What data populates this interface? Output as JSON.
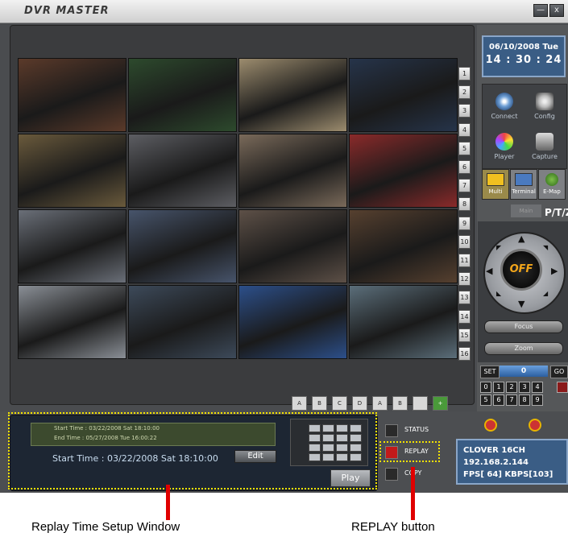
{
  "app": {
    "title": "DVR MASTER",
    "win_min": "—",
    "win_close": "x"
  },
  "camera_grid": {
    "cells": [
      {
        "c": "#5b3a2a"
      },
      {
        "c": "#2d4a2d"
      },
      {
        "c": "#9c8c6e"
      },
      {
        "c": "#26344a"
      },
      {
        "c": "#6a5a3c"
      },
      {
        "c": "#5d5e63"
      },
      {
        "c": "#7a6a5a"
      },
      {
        "c": "#8a2a2a"
      },
      {
        "c": "#6a6f78"
      },
      {
        "c": "#47546b"
      },
      {
        "c": "#5d5047"
      },
      {
        "c": "#56402f"
      },
      {
        "c": "#8a8f96"
      },
      {
        "c": "#3d4a5a"
      },
      {
        "c": "#2c4f8a"
      },
      {
        "c": "#5b6e7a"
      }
    ],
    "channels": [
      "1",
      "2",
      "3",
      "4",
      "5",
      "6",
      "7",
      "8",
      "9",
      "10",
      "11",
      "12",
      "13",
      "14",
      "15",
      "16"
    ],
    "layout_buttons": [
      "A",
      "B",
      "C",
      "D",
      "A",
      "B",
      "",
      "+"
    ]
  },
  "clock": {
    "date": "06/10/2008 Tue",
    "time": "14 : 30 : 24"
  },
  "right_buttons": [
    {
      "label": "Connect",
      "icon": "connect-icon",
      "color": "#6fa0d6"
    },
    {
      "label": "Config",
      "icon": "config-icon",
      "color": "#c8c8c8"
    },
    {
      "label": "Player",
      "icon": "player-icon",
      "color": "#8a7ad6"
    },
    {
      "label": "Capture",
      "icon": "capture-icon",
      "color": "#8f8f8f"
    }
  ],
  "tabs": [
    {
      "label": "Multi",
      "icon": "multi-icon"
    },
    {
      "label": "Terminal",
      "icon": "terminal-icon"
    },
    {
      "label": "E-Map",
      "icon": "emap-icon"
    }
  ],
  "ptz": {
    "title": "P/T/Z",
    "main_label": "Main Layer",
    "off_label": "OFF",
    "focus_label": "Focus",
    "zoom_label": "Zoom",
    "set_label": "SET",
    "value": "0",
    "go_label": "GO",
    "numbers": [
      "0",
      "1",
      "2",
      "3",
      "4",
      "5",
      "6",
      "7",
      "8",
      "9"
    ]
  },
  "replay": {
    "info_start": "Start Time : 03/22/2008 Sat 18:10:00",
    "info_end": "End Time : 05/27/2008 Tue 16:00:22",
    "start_time": "Start Time : 03/22/2008 Sat 18:10:00",
    "edit_label": "Edit",
    "play_label": "Play"
  },
  "mode_buttons": {
    "status": "STATUS",
    "replay": "REPLAY",
    "copy": "COPY"
  },
  "status_box": {
    "name": "CLOVER 16CH",
    "ip": "192.168.2.144",
    "fps": "FPS[ 64]  KBPS[103]"
  },
  "annotations": {
    "window": "Replay Time Setup Window",
    "button": "REPLAY    button"
  }
}
